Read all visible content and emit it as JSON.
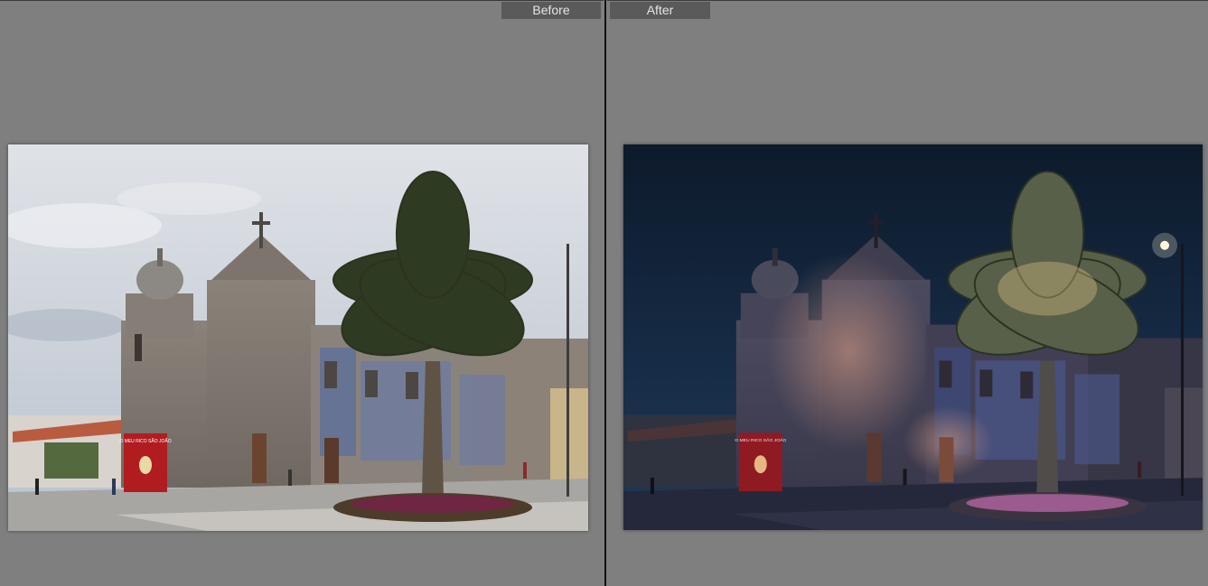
{
  "compare": {
    "before": {
      "label": "Before"
    },
    "after": {
      "label": "After"
    }
  },
  "poster_text": "O MEU RICO SÃO JOÃO",
  "colors": {
    "background": "#7f7f7f",
    "label_bg": "#5a5a5a",
    "label_text": "#e6e6e6",
    "divider": "#121212"
  },
  "icons": {
    "photo_before": "church-daytime-photo",
    "photo_after": "church-night-edit-photo"
  }
}
